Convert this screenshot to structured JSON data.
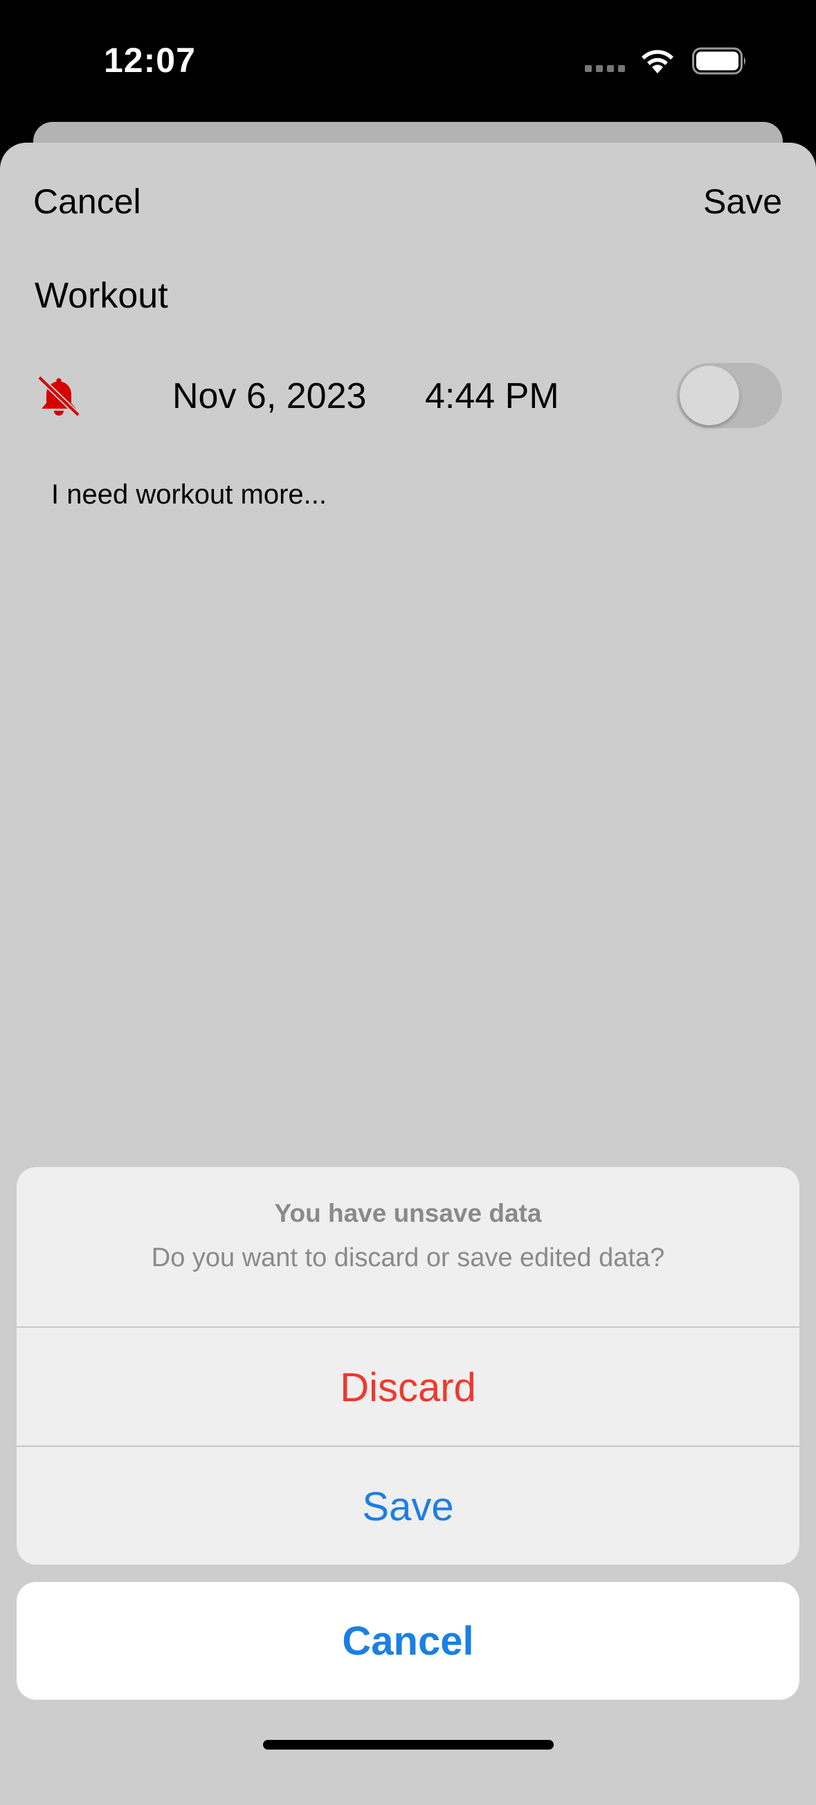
{
  "status_bar": {
    "time": "12:07",
    "icons": [
      "signal-dots-icon",
      "wifi-icon",
      "battery-icon"
    ]
  },
  "nav": {
    "cancel_label": "Cancel",
    "save_label": "Save"
  },
  "reminder": {
    "title": "Workout",
    "bell_icon": "bell-slash-icon",
    "bell_color": "#d60000",
    "date": "Nov 6, 2023",
    "time": "4:44 PM",
    "alert_enabled": false,
    "note": "I need workout more..."
  },
  "action_sheet": {
    "title": "You have unsave data",
    "message": "Do you want to discard or save edited data?",
    "discard_label": "Discard",
    "discard_color": "#f0382c",
    "save_label": "Save",
    "cancel_label": "Cancel",
    "accent_color": "#1b7fe3"
  }
}
